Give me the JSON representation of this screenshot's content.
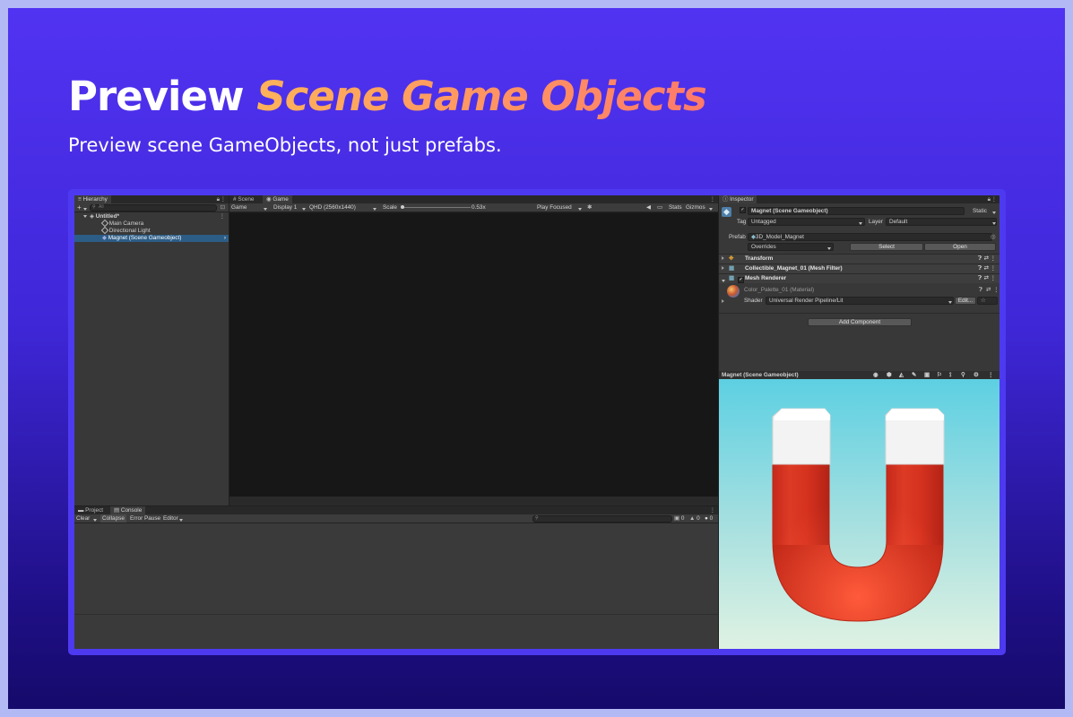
{
  "banner": {
    "title_plain": "Preview ",
    "title_accent": "Scene Game Objects",
    "subtitle": "Preview scene GameObjects, not just prefabs."
  },
  "hierarchy": {
    "tab": "Hierarchy",
    "search_placeholder": "All",
    "scene": "Untitled*",
    "items": [
      "Main Camera",
      "Directional Light",
      "Magnet (Scene Gameobject)"
    ]
  },
  "game_view": {
    "tabs": [
      "Scene",
      "Game"
    ],
    "mode": "Game",
    "display": "Display 1",
    "resolution": "QHD (2560x1440)",
    "scale_label": "Scale",
    "scale_value": "0.53x",
    "play_focused": "Play Focused",
    "stats": "Stats",
    "gizmos": "Gizmos"
  },
  "console": {
    "tabs": [
      "Project",
      "Console"
    ],
    "clear": "Clear",
    "collapse": "Collapse",
    "error_pause": "Error Pause",
    "editor": "Editor",
    "count_warnings": "0",
    "count_messages": "0",
    "count_errors": "0"
  },
  "inspector": {
    "tab": "Inspector",
    "object_name": "Magnet (Scene Gameobject)",
    "static_label": "Static",
    "tag_label": "Tag",
    "tag_value": "Untagged",
    "layer_label": "Layer",
    "layer_value": "Default",
    "prefab_label": "Prefab",
    "prefab_value": "3D_Model_Magnet",
    "overrides": "Overrides",
    "select": "Select",
    "open": "Open",
    "components": [
      "Transform",
      "Collectible_Magnet_01 (Mesh Filter)",
      "Mesh Renderer"
    ],
    "material": "Color_Palette_01 (Material)",
    "shader_label": "Shader",
    "shader_value": "Universal Render Pipeline/Lit",
    "edit": "Edit...",
    "add_component": "Add Component",
    "preview_title": "Magnet (Scene Gameobject)"
  },
  "colors": {
    "accent_gradient_start": "#ffb25a",
    "accent_gradient_end": "#ff7a6a",
    "selection": "#2c5d87",
    "magnet_red": "#e63a25",
    "magnet_tip": "#f2f2f2"
  }
}
